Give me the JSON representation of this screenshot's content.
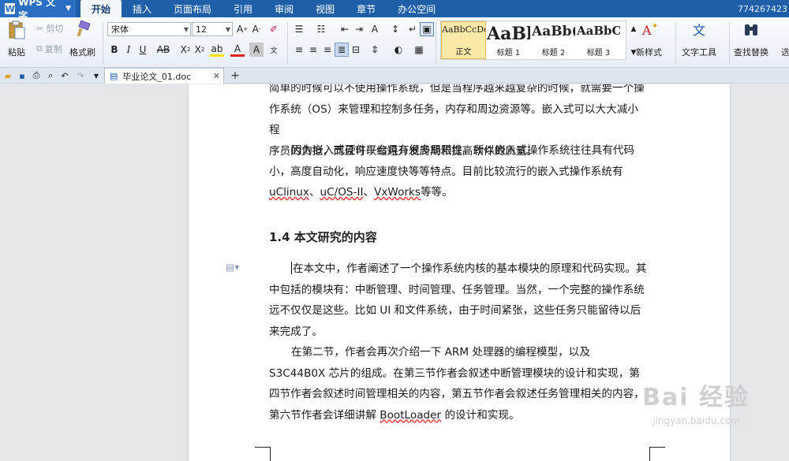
{
  "app": {
    "name": "WPS 文字",
    "user_id": "774267423"
  },
  "menu_tabs": [
    "开始",
    "插入",
    "页面布局",
    "引用",
    "审阅",
    "视图",
    "章节",
    "办公空间"
  ],
  "ribbon": {
    "paste": "粘贴",
    "cut": "剪切",
    "copy": "复制",
    "format_painter": "格式刷",
    "font_name": "宋体",
    "font_size": "12",
    "styles": [
      {
        "preview": "AaBbCcDd",
        "name": "正文"
      },
      {
        "preview": "AaBl",
        "name": "标题 1"
      },
      {
        "preview": "AaBb(",
        "name": "标题 2"
      },
      {
        "preview": "AaBbC",
        "name": "标题 3"
      }
    ],
    "new_style": "新样式",
    "text_tools": "文字工具",
    "find_replace": "查找替换",
    "select": "选"
  },
  "document": {
    "tab_name": "毕业论文_01.doc",
    "para1_lines": [
      "简单的时候可以不使用操作系统，但是当程序越来越复杂的时候，就需要一个操",
      "作系统（OS）来管理和控制多任务，内存和周边资源等。嵌入式可以大大减小程",
      "序员的负担，而且可以缩短开发周期和提高软件的质量。"
    ],
    "para2": "因为嵌入式硬件平台具有很多局限性，所以嵌入式操作系统往往具有代码小，高度自动化，响应速度快等等特点。目前比较流行的嵌入式操作系统有",
    "para2_tail": {
      "t1": "uClinux",
      "s1": "、",
      "t2": "uC/OS-II",
      "s2": "、",
      "t3": "VxWorks",
      "s3": "等等。"
    },
    "heading": "1.4 本文研究的内容",
    "para3": "在本文中，作者阐述了一个操作系统内核的基本模块的原理和代码实现。其中包括的模块有：中断管理、时间管理、任务管理。当然，一个完整的操作系统远不仅仅是这些。比如 UI 和文件系统，由于时间紧张，这些任务只能留待以后来完成了。",
    "para4_a": "在第二节，作者会再次介绍一下 ARM 处理器的编程模型，以及 S3C44B0X 芯片的组成。在第三节作者会叙述中断管理模块的设计和实现，第四节作者会叙述时间管理相关的内容，第五节作者会叙述任务管理相关的内容，第六节作者会详细讲解 ",
    "para4_term": "BootLoader",
    "para4_b": " 的设计和实现。"
  },
  "watermark": {
    "text": "Bai 经验",
    "url": "jingyan.baidu.com"
  }
}
